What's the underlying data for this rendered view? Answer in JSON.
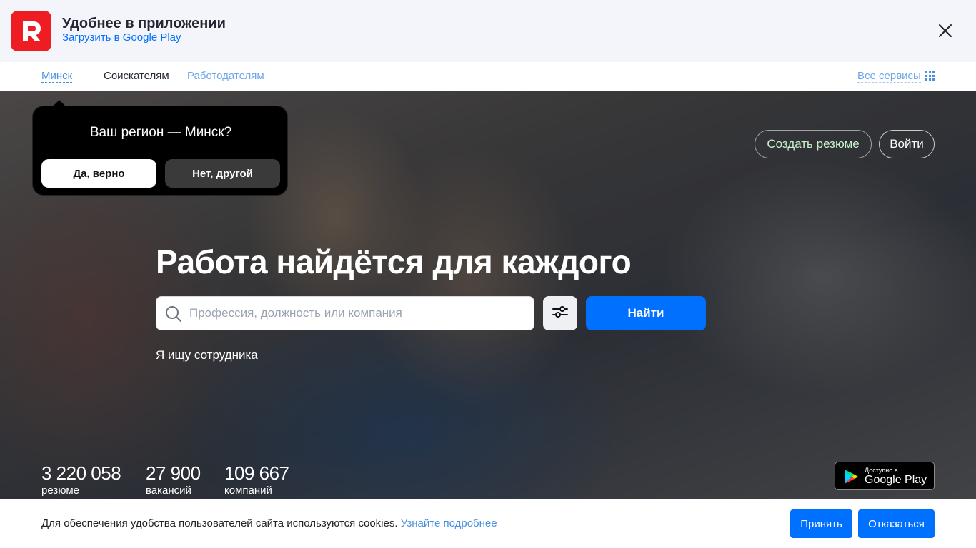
{
  "app_banner": {
    "title": "Удобнее в приложении",
    "store_link": "Загрузить в Google Play",
    "logo_icon": "rabota-logo-icon",
    "close_icon": "close-icon"
  },
  "nav": {
    "city": "Минск",
    "seekers": "Соискателям",
    "employers": "Работодателям",
    "all_services": "Все сервисы",
    "services_icon": "grid-icon"
  },
  "region_popup": {
    "question": "Ваш регион — Минск?",
    "yes": "Да, верно",
    "no": "Нет, другой"
  },
  "header_actions": {
    "create_resume": "Создать резюме",
    "login": "Войти"
  },
  "hero": {
    "title": "Работа найдётся для каждого",
    "search_placeholder": "Профессия, должность или компания",
    "search_value": "",
    "find_button": "Найти",
    "filter_icon": "sliders-icon",
    "employer_link": "Я ищу сотрудника"
  },
  "stats": [
    {
      "value": "3 220 058",
      "label": "резюме"
    },
    {
      "value": "27 900",
      "label": "вакансий"
    },
    {
      "value": "109 667",
      "label": "компаний"
    }
  ],
  "store_badge": {
    "small": "Доступно в",
    "big": "Google Play"
  },
  "cookie_bar": {
    "text": "Для обеспечения удобства пользователей сайта используются cookies.",
    "link": "Узнайте подробнее",
    "accept": "Принять",
    "decline": "Отказаться"
  },
  "colors": {
    "brand_red": "#ee1d23",
    "accent_blue": "#0070ff",
    "link_blue": "#4a90e2"
  }
}
